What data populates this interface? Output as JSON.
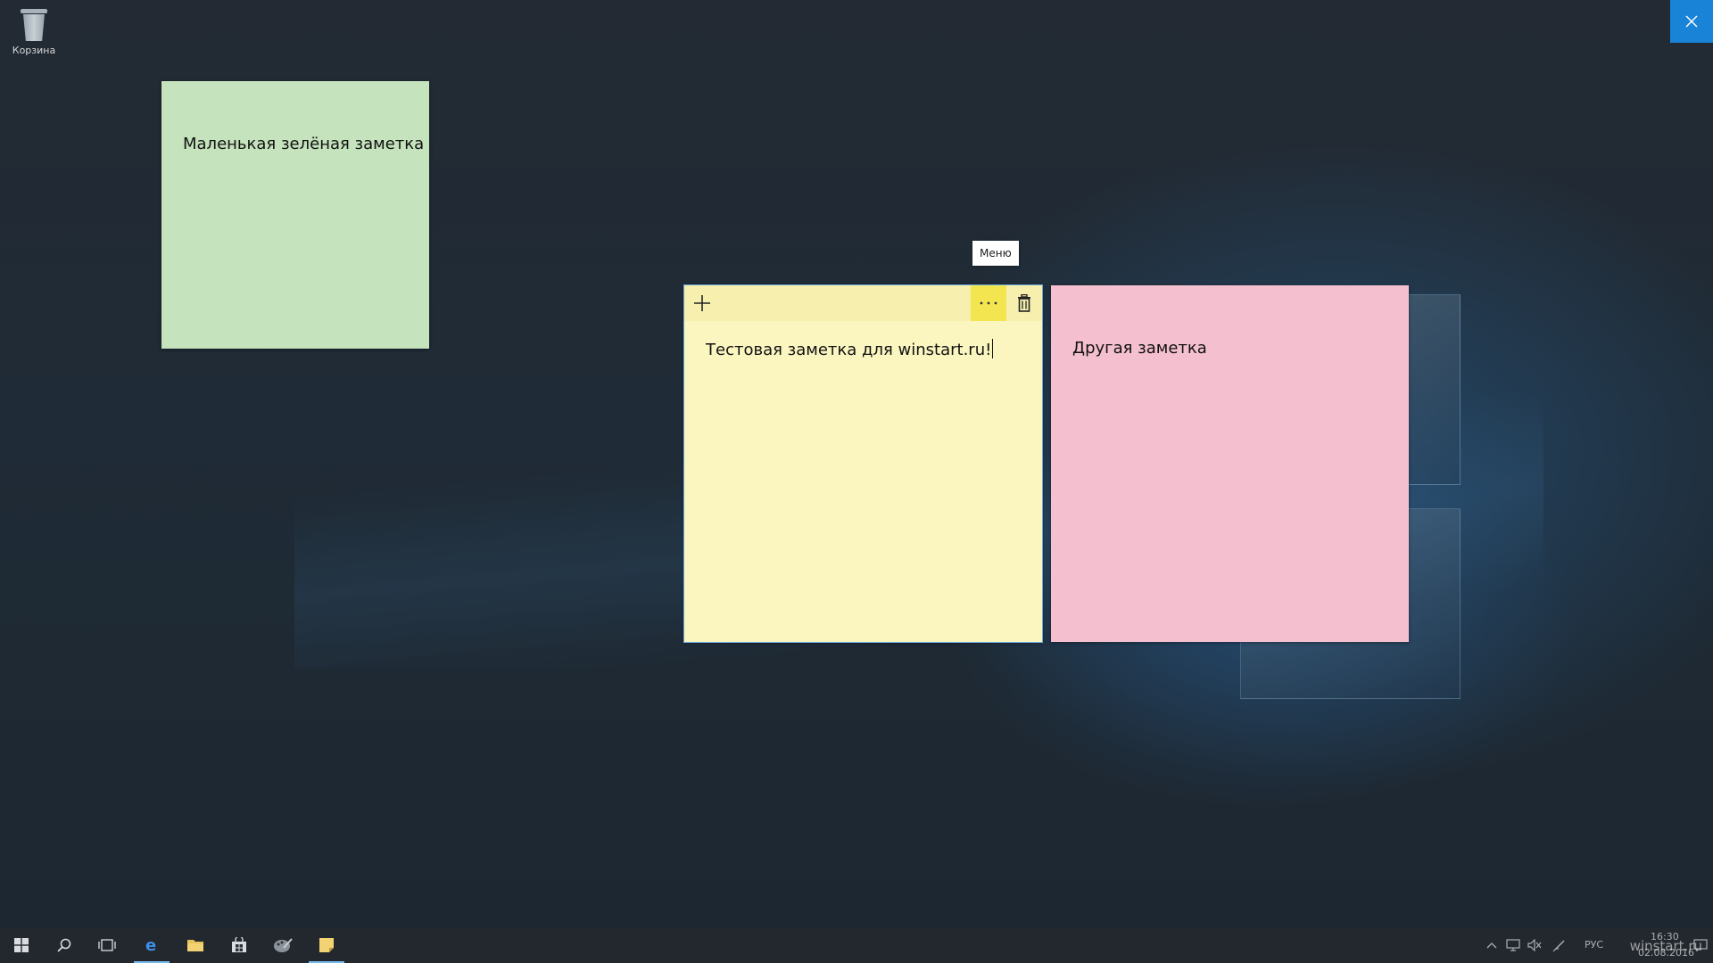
{
  "desktop": {
    "recycle_bin_label": "Корзина"
  },
  "notes": {
    "green": {
      "text": "Маленькая зелёная заметка",
      "color": "#c5e3bc"
    },
    "yellow": {
      "text": "Тестовая заметка для winstart.ru!",
      "color": "#fbf6c0"
    },
    "pink": {
      "text": "Другая заметка",
      "color": "#f4c0cf"
    }
  },
  "tooltip": {
    "menu_label": "Меню"
  },
  "taskbar": {
    "icons": [
      "windows-start-icon",
      "search-icon",
      "task-view-icon",
      "edge-icon",
      "file-explorer-icon",
      "store-icon",
      "paint-icon",
      "sticky-notes-icon"
    ],
    "tray": {
      "language": "РУС",
      "time": "16:30",
      "date": "02.08.2016"
    }
  },
  "watermark": "winstart.ru",
  "colors": {
    "accent": "#1883d7",
    "menu_hover": "#f2e550"
  }
}
